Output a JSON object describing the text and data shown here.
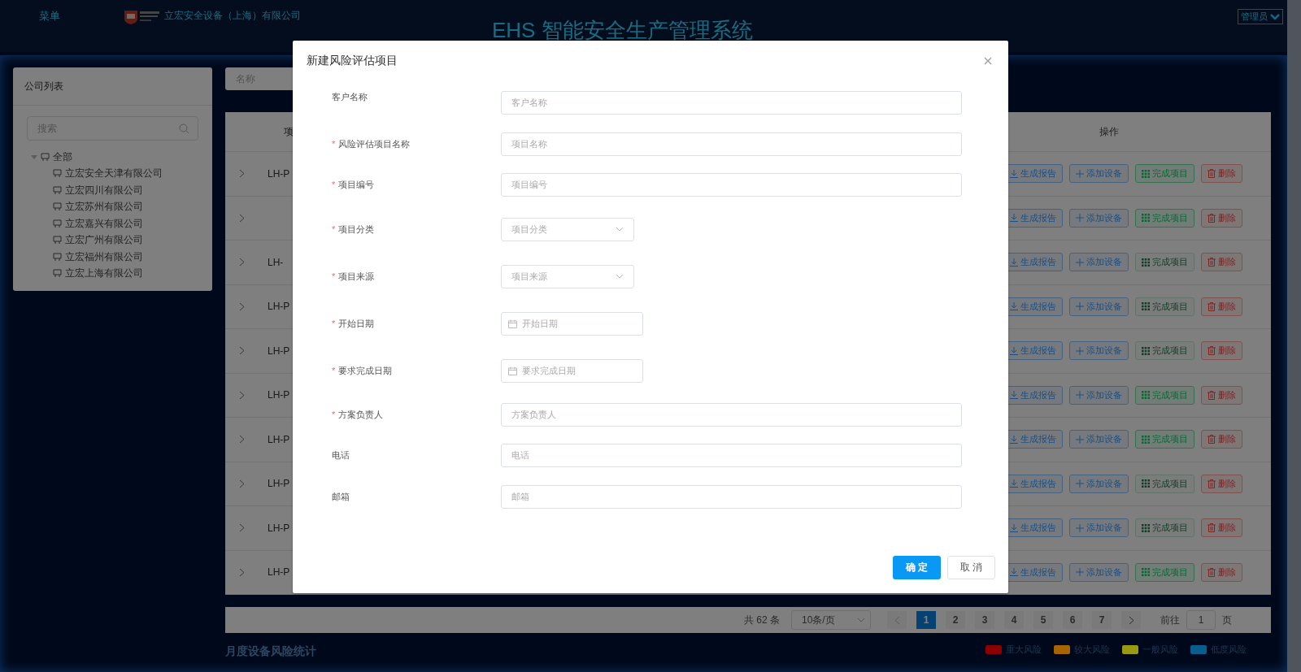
{
  "header": {
    "menu": "菜单",
    "company": "立宏安全设备（上海）有限公司",
    "title": "EHS 智能安全生产管理系统",
    "user": "管理员"
  },
  "sidebar": {
    "title": "公司列表",
    "search_placeholder": "搜索",
    "tree": [
      {
        "label": "全部",
        "expanded": true,
        "children": [
          {
            "label": "立宏安全天津有限公司"
          },
          {
            "label": "立宏四川有限公司"
          },
          {
            "label": "立宏苏州有限公司"
          },
          {
            "label": "立宏嘉兴有限公司"
          },
          {
            "label": "立宏广州有限公司"
          },
          {
            "label": "立宏福州有限公司"
          },
          {
            "label": "立宏上海有限公司"
          }
        ]
      }
    ]
  },
  "filter": {
    "placeholder": "名称"
  },
  "table": {
    "columns": [
      "项",
      "操作"
    ],
    "rows": [
      {
        "code": "LH-P",
        "actions": [
          {
            "kind": "report",
            "label": "生成报告"
          },
          {
            "kind": "add",
            "label": "添加设备"
          },
          {
            "kind": "complete",
            "label": "完成项目",
            "disabled": false
          },
          {
            "kind": "delete",
            "label": "删除"
          }
        ]
      },
      {
        "actions": [
          {
            "kind": "report",
            "label": "生成报告"
          },
          {
            "kind": "add",
            "label": "添加设备"
          },
          {
            "kind": "complete",
            "label": "完成项目",
            "disabled": false
          },
          {
            "kind": "delete",
            "label": "删除"
          }
        ]
      },
      {
        "code": "LH-",
        "actions": [
          {
            "kind": "report",
            "label": "生成报告"
          },
          {
            "kind": "add",
            "label": "添加设备"
          },
          {
            "kind": "complete",
            "label": "完成项目",
            "disabled": true
          },
          {
            "kind": "delete",
            "label": "删除"
          }
        ]
      },
      {
        "code": "LH-P",
        "actions": [
          {
            "kind": "report",
            "label": "生成报告"
          },
          {
            "kind": "add",
            "label": "添加设备"
          },
          {
            "kind": "complete",
            "label": "完成项目",
            "disabled": true
          },
          {
            "kind": "delete",
            "label": "删除"
          }
        ]
      },
      {
        "code": "LH-P",
        "actions": [
          {
            "kind": "report",
            "label": "生成报告"
          },
          {
            "kind": "add",
            "label": "添加设备"
          },
          {
            "kind": "complete",
            "label": "完成项目",
            "disabled": true
          },
          {
            "kind": "delete",
            "label": "删除"
          }
        ]
      },
      {
        "code": "LH-P",
        "actions": [
          {
            "kind": "report",
            "label": "生成报告"
          },
          {
            "kind": "add",
            "label": "添加设备"
          },
          {
            "kind": "complete",
            "label": "完成项目",
            "disabled": false
          },
          {
            "kind": "delete",
            "label": "删除"
          }
        ]
      },
      {
        "code": "LH-P",
        "actions": [
          {
            "kind": "report",
            "label": "生成报告"
          },
          {
            "kind": "add",
            "label": "添加设备"
          },
          {
            "kind": "complete",
            "label": "完成项目",
            "disabled": false
          },
          {
            "kind": "delete",
            "label": "删除"
          }
        ]
      },
      {
        "code": "LH-P",
        "actions": [
          {
            "kind": "report",
            "label": "生成报告"
          },
          {
            "kind": "add",
            "label": "添加设备"
          },
          {
            "kind": "complete",
            "label": "完成项目",
            "disabled": true
          },
          {
            "kind": "delete",
            "label": "删除"
          }
        ]
      },
      {
        "code": "LH-P",
        "actions": [
          {
            "kind": "report",
            "label": "生成报告"
          },
          {
            "kind": "add",
            "label": "添加设备"
          },
          {
            "kind": "complete",
            "label": "完成项目",
            "disabled": true
          },
          {
            "kind": "delete",
            "label": "删除"
          }
        ]
      },
      {
        "code": "LH-P",
        "actions": [
          {
            "kind": "report",
            "label": "生成报告"
          },
          {
            "kind": "add",
            "label": "添加设备"
          },
          {
            "kind": "complete",
            "label": "完成项目",
            "disabled": false
          },
          {
            "kind": "delete",
            "label": "删除"
          }
        ]
      }
    ]
  },
  "pagination": {
    "total": "共 62 条",
    "page_size": "10条/页",
    "pages": [
      {
        "label": "1",
        "selected": true
      },
      {
        "label": "2",
        "selected": false
      },
      {
        "label": "3",
        "selected": false
      },
      {
        "label": "4",
        "selected": false
      },
      {
        "label": "5",
        "selected": false
      },
      {
        "label": "6",
        "selected": false
      },
      {
        "label": "7",
        "selected": false
      }
    ],
    "goto_label": "前往",
    "goto_value": "1",
    "goto_suffix": "页"
  },
  "chart_section": {
    "title": "月度设备风险统计",
    "legend": [
      {
        "label": "重大风险",
        "color": "#8c0000"
      },
      {
        "label": "较大风险",
        "color": "#a86400"
      },
      {
        "label": "一般风险",
        "color": "#9a9a10"
      },
      {
        "label": "低度风险",
        "color": "#0a5e8e"
      }
    ]
  },
  "dialog": {
    "title": "新建风险评估项目",
    "required_mark": "*",
    "fields": [
      {
        "kind": "text",
        "label": "客户名称",
        "required": false,
        "placeholder": "客户名称"
      },
      {
        "kind": "text",
        "label": "风险评估项目名称",
        "required": true,
        "placeholder": "项目名称"
      },
      {
        "kind": "text",
        "label": "项目编号",
        "required": true,
        "placeholder": "项目编号"
      },
      {
        "kind": "select",
        "label": "项目分类",
        "required": true,
        "placeholder": "项目分类"
      },
      {
        "kind": "select",
        "label": "项目来源",
        "required": true,
        "placeholder": "项目来源"
      },
      {
        "kind": "date",
        "label": "开始日期",
        "required": true,
        "placeholder": "开始日期"
      },
      {
        "kind": "date",
        "label": "要求完成日期",
        "required": true,
        "placeholder": "要求完成日期"
      },
      {
        "kind": "text",
        "label": "方案负责人",
        "required": true,
        "placeholder": "方案负责人"
      },
      {
        "kind": "text",
        "label": "电话",
        "required": false,
        "placeholder": "电话"
      },
      {
        "kind": "text",
        "label": "邮箱",
        "required": false,
        "placeholder": "邮箱"
      }
    ],
    "confirm": "确 定",
    "cancel": "取 消"
  }
}
